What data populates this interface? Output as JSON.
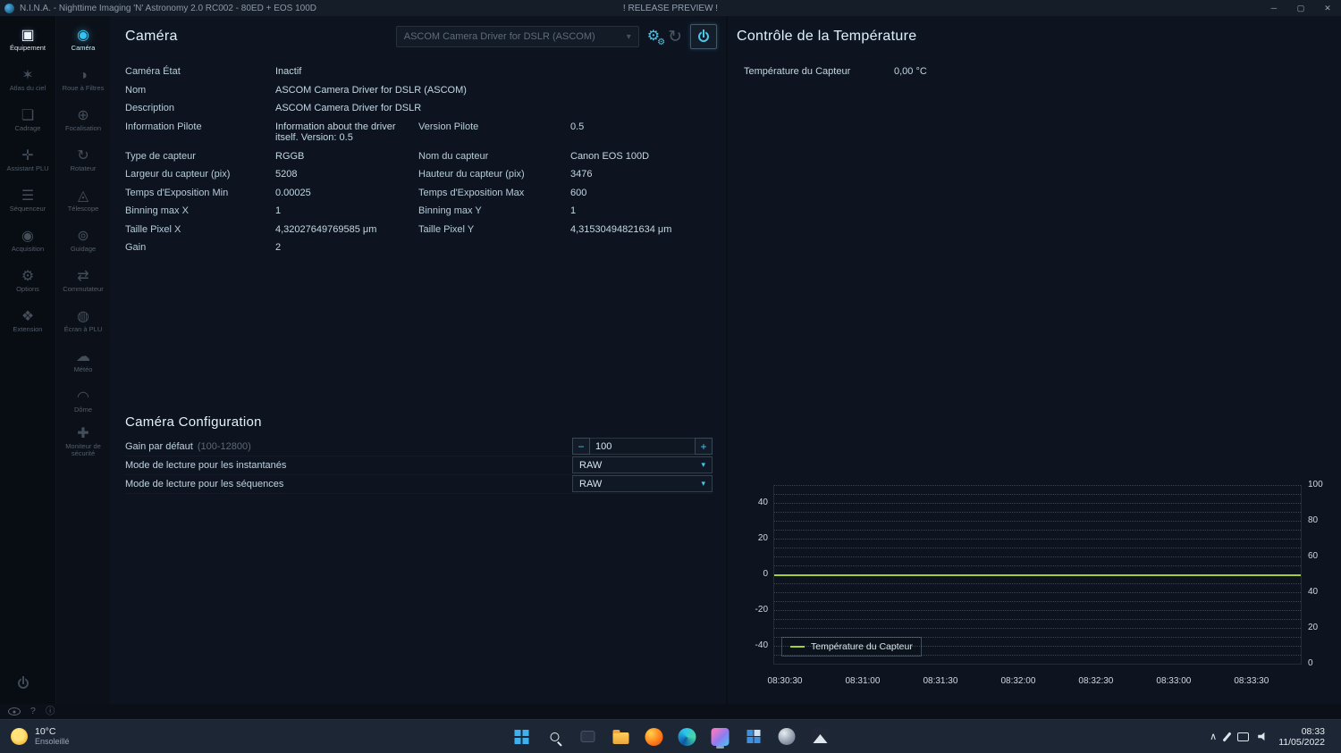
{
  "window": {
    "title": "N.I.N.A. - Nighttime Imaging 'N' Astronomy 2.0 RC002  -  80ED + EOS 100D",
    "banner": "! RELEASE PREVIEW !"
  },
  "icons": {
    "minimize": "─",
    "maximize": "▢",
    "close": "✕",
    "chevron_down": "▾",
    "chevron_up": "∧",
    "gear": "⚙",
    "refresh": "↻",
    "minus": "−",
    "plus": "+",
    "question": "?",
    "info": "ⓘ"
  },
  "sidebar": {
    "primary": [
      {
        "id": "equipement",
        "label": "Équipement",
        "glyph": "▣",
        "active": true
      },
      {
        "id": "atlas-du-ciel",
        "label": "Atlas du ciel",
        "glyph": "✶",
        "active": false
      },
      {
        "id": "cadrage",
        "label": "Cadrage",
        "glyph": "❏",
        "active": false
      },
      {
        "id": "assistant-plu",
        "label": "Assistant PLU",
        "glyph": "✛",
        "active": false
      },
      {
        "id": "sequenceur",
        "label": "Séquenceur",
        "glyph": "☰",
        "active": false
      },
      {
        "id": "acquisition",
        "label": "Acquisition",
        "glyph": "◉",
        "active": false
      },
      {
        "id": "options",
        "label": "Options",
        "glyph": "⚙",
        "active": false
      },
      {
        "id": "extension",
        "label": "Extension",
        "glyph": "❖",
        "active": false
      }
    ],
    "secondary": [
      {
        "id": "camera",
        "label": "Caméra",
        "glyph": "◉",
        "active": true
      },
      {
        "id": "roue-a-filtres",
        "label": "Roue à Filtres",
        "glyph": "◑",
        "active": false
      },
      {
        "id": "focalisation",
        "label": "Focalisation",
        "glyph": "⊕",
        "active": false
      },
      {
        "id": "rotateur",
        "label": "Rotateur",
        "glyph": "↻",
        "active": false
      },
      {
        "id": "telescope",
        "label": "Télescope",
        "glyph": "◬",
        "active": false
      },
      {
        "id": "guidage",
        "label": "Guidage",
        "glyph": "⊚",
        "active": false
      },
      {
        "id": "commutateur",
        "label": "Commutateur",
        "glyph": "⇄",
        "active": false
      },
      {
        "id": "ecran-a-plu",
        "label": "Écran à PLU",
        "glyph": "◍",
        "active": false
      },
      {
        "id": "meteo",
        "label": "Météo",
        "glyph": "☁",
        "active": false
      },
      {
        "id": "dome",
        "label": "Dôme",
        "glyph": "◠",
        "active": false
      },
      {
        "id": "moniteur-de-securite",
        "label": "Moniteur de sécurité",
        "glyph": "✚",
        "active": false
      }
    ]
  },
  "camera": {
    "title": "Caméra",
    "device": "ASCOM Camera Driver for DSLR (ASCOM)",
    "rows": [
      {
        "l1": "Caméra État",
        "v1": "Inactif"
      },
      {
        "l1": "Nom",
        "v1": "ASCOM Camera Driver for DSLR (ASCOM)"
      },
      {
        "l1": "Description",
        "v1": "ASCOM Camera Driver for DSLR"
      },
      {
        "l1": "Information Pilote",
        "v1": "Information about the driver itself. Version: 0.5",
        "l2": "Version Pilote",
        "v2": "0.5"
      },
      {
        "l1": "Type de capteur",
        "v1": "RGGB",
        "l2": "Nom du capteur",
        "v2": "Canon EOS 100D"
      },
      {
        "l1": "Largeur du capteur (pix)",
        "v1": "5208",
        "l2": "Hauteur du capteur (pix)",
        "v2": "3476"
      },
      {
        "l1": "Temps d'Exposition Min",
        "v1": "0.00025",
        "l2": "Temps d'Exposition Max",
        "v2": "600"
      },
      {
        "l1": "Binning max X",
        "v1": "1",
        "l2": "Binning max Y",
        "v2": "1"
      },
      {
        "l1": "Taille Pixel X",
        "v1": "4,32027649769585 μm",
        "l2": "Taille Pixel Y",
        "v2": "4,31530494821634 μm"
      },
      {
        "l1": "Gain",
        "v1": "2"
      }
    ],
    "config": {
      "title": "Caméra Configuration",
      "gain_label": "Gain par défaut",
      "gain_hint": "(100-12800)",
      "gain_value": "100",
      "readout_snapshot_label": "Mode de lecture pour les instantanés",
      "readout_snapshot_value": "RAW",
      "readout_sequence_label": "Mode de lecture pour les séquences",
      "readout_sequence_value": "RAW"
    }
  },
  "temperature": {
    "title": "Contrôle de la Température",
    "sensor_label": "Température du Capteur",
    "sensor_value": "0,00 °C"
  },
  "chart_data": {
    "type": "line",
    "title": "",
    "x": [
      "08:30:30",
      "08:31:00",
      "08:31:30",
      "08:32:00",
      "08:32:30",
      "08:33:00",
      "08:33:30"
    ],
    "series": [
      {
        "name": "Température du Capteur",
        "color": "#a6ce39",
        "values": [
          0,
          0,
          0,
          0,
          0,
          0,
          0
        ]
      }
    ],
    "y_left": {
      "ticks": [
        40,
        20,
        0,
        -20,
        -40
      ],
      "range": [
        -50,
        50
      ]
    },
    "y_right": {
      "ticks": [
        100,
        80,
        60,
        40,
        20,
        0
      ],
      "range": [
        0,
        100
      ]
    },
    "grid": "dotted-horizontal",
    "legend": {
      "label": "Température du Capteur",
      "position": "bottom-left"
    }
  },
  "taskbar": {
    "weather": {
      "temp": "10°C",
      "condition": "Ensoleillé"
    },
    "clock": {
      "time": "08:33",
      "date": "11/05/2022"
    }
  }
}
